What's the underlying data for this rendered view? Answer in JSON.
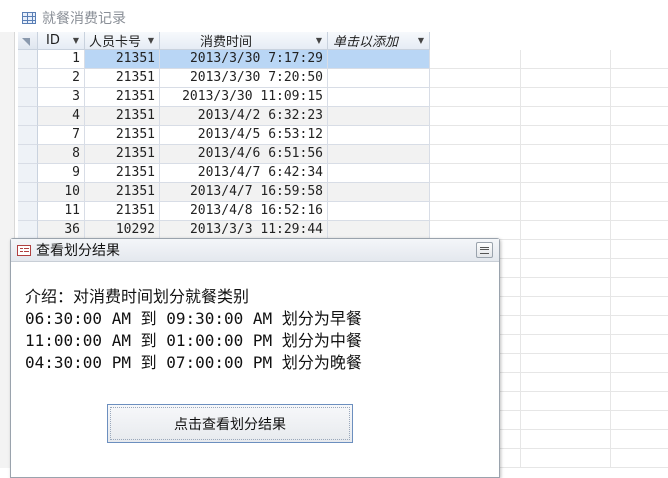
{
  "table": {
    "title": "就餐消费记录",
    "columns": {
      "id": "ID",
      "card": "人员卡号",
      "time": "消费时间",
      "add": "单击以添加"
    },
    "rows": [
      {
        "id": "1",
        "card": "21351",
        "time": "2013/3/30 7:17:29"
      },
      {
        "id": "2",
        "card": "21351",
        "time": "2013/3/30 7:20:50"
      },
      {
        "id": "3",
        "card": "21351",
        "time": "2013/3/30 11:09:15"
      },
      {
        "id": "4",
        "card": "21351",
        "time": "2013/4/2 6:32:23"
      },
      {
        "id": "7",
        "card": "21351",
        "time": "2013/4/5 6:53:12"
      },
      {
        "id": "8",
        "card": "21351",
        "time": "2013/4/6 6:51:56"
      },
      {
        "id": "9",
        "card": "21351",
        "time": "2013/4/7 6:42:34"
      },
      {
        "id": "10",
        "card": "21351",
        "time": "2013/4/7 16:59:58"
      },
      {
        "id": "11",
        "card": "21351",
        "time": "2013/4/8 16:52:16"
      },
      {
        "id": "36",
        "card": "10292",
        "time": "2013/3/3 11:29:44"
      }
    ]
  },
  "dialog": {
    "title": "查看划分结果",
    "intro": "介绍：对消费时间划分就餐类别",
    "lines": [
      "06:30:00 AM 到 09:30:00 AM 划分为早餐",
      "11:00:00 AM 到 01:00:00 PM 划分为中餐",
      "04:30:00 PM 到 07:00:00 PM 划分为晚餐"
    ],
    "button_label": "点击查看划分结果"
  },
  "colors": {
    "selected_row": "#b9d6f5",
    "header_bg": "#e6ecf5",
    "button_border": "#6c8fbf"
  },
  "icons": {
    "table": "table-icon",
    "form": "form-icon",
    "close": "close-icon",
    "dropdown": "chevron-down-icon"
  }
}
